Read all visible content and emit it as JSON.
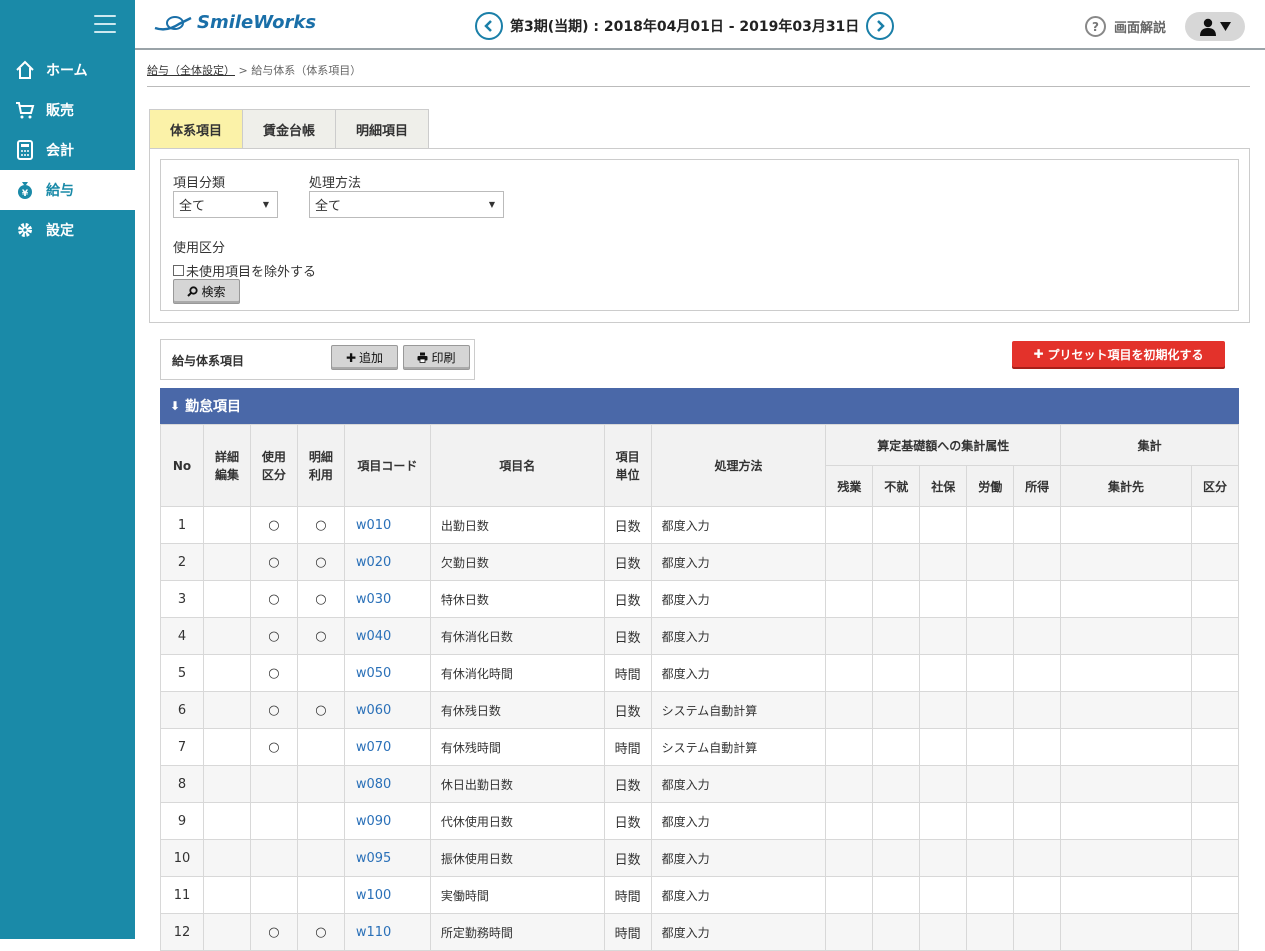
{
  "app": {
    "logo": "SmileWorks",
    "brand_color": "#1a8aa8"
  },
  "nav": [
    {
      "label": "ホーム",
      "icon": "home-icon",
      "active": false
    },
    {
      "label": "販売",
      "icon": "cart-icon",
      "active": false
    },
    {
      "label": "会計",
      "icon": "calculator-icon",
      "active": false
    },
    {
      "label": "給与",
      "icon": "money-bag-icon",
      "active": true
    },
    {
      "label": "設定",
      "icon": "gear-icon",
      "active": false
    }
  ],
  "header": {
    "period": "第3期(当期) : 2018年04月01日 - 2019年03月31日",
    "help_label": "画面解説"
  },
  "breadcrumb": {
    "link": "給与（全体設定）",
    "sep": ">",
    "current": "給与体系（体系項目）"
  },
  "tabs": [
    "体系項目",
    "賃金台帳",
    "明細項目"
  ],
  "filter": {
    "category_label": "項目分類",
    "category_value": "全て",
    "method_label": "処理方法",
    "method_value": "全て",
    "usage_label": "使用区分",
    "exclude_label": "未使用項目を除外する",
    "search_label": "検索"
  },
  "toolbar": {
    "title": "給与体系項目",
    "add_label": "追加",
    "print_label": "印刷",
    "reset_label": "プリセット項目を初期化する"
  },
  "section_title": "勤怠項目",
  "table": {
    "headers": {
      "no": "No",
      "detail_edit": "詳細編集",
      "usage": "使用区分",
      "detail_use": "明細利用",
      "code": "項目コード",
      "name": "項目名",
      "unit": "項目単位",
      "method": "処理方法",
      "calc_attr": "算定基礎額への集計属性",
      "sum": "集計",
      "overtime": "残業",
      "absence": "不就",
      "social": "社保",
      "labor": "労働",
      "income": "所得",
      "sum_target": "集計先",
      "sum_class": "区分"
    },
    "rows": [
      {
        "no": "1",
        "usage": "○",
        "detail": "○",
        "code": "w010",
        "name": "出勤日数",
        "unit": "日数",
        "method": "都度入力"
      },
      {
        "no": "2",
        "usage": "○",
        "detail": "○",
        "code": "w020",
        "name": "欠勤日数",
        "unit": "日数",
        "method": "都度入力"
      },
      {
        "no": "3",
        "usage": "○",
        "detail": "○",
        "code": "w030",
        "name": "特休日数",
        "unit": "日数",
        "method": "都度入力"
      },
      {
        "no": "4",
        "usage": "○",
        "detail": "○",
        "code": "w040",
        "name": "有休消化日数",
        "unit": "日数",
        "method": "都度入力"
      },
      {
        "no": "5",
        "usage": "○",
        "detail": "",
        "code": "w050",
        "name": "有休消化時間",
        "unit": "時間",
        "method": "都度入力"
      },
      {
        "no": "6",
        "usage": "○",
        "detail": "○",
        "code": "w060",
        "name": "有休残日数",
        "unit": "日数",
        "method": "システム自動計算"
      },
      {
        "no": "7",
        "usage": "○",
        "detail": "",
        "code": "w070",
        "name": "有休残時間",
        "unit": "時間",
        "method": "システム自動計算"
      },
      {
        "no": "8",
        "usage": "",
        "detail": "",
        "code": "w080",
        "name": "休日出勤日数",
        "unit": "日数",
        "method": "都度入力"
      },
      {
        "no": "9",
        "usage": "",
        "detail": "",
        "code": "w090",
        "name": "代休使用日数",
        "unit": "日数",
        "method": "都度入力"
      },
      {
        "no": "10",
        "usage": "",
        "detail": "",
        "code": "w095",
        "name": "振休使用日数",
        "unit": "日数",
        "method": "都度入力"
      },
      {
        "no": "11",
        "usage": "",
        "detail": "",
        "code": "w100",
        "name": "実働時間",
        "unit": "時間",
        "method": "都度入力"
      },
      {
        "no": "12",
        "usage": "○",
        "detail": "○",
        "code": "w110",
        "name": "所定勤務時間",
        "unit": "時間",
        "method": "都度入力"
      }
    ]
  }
}
